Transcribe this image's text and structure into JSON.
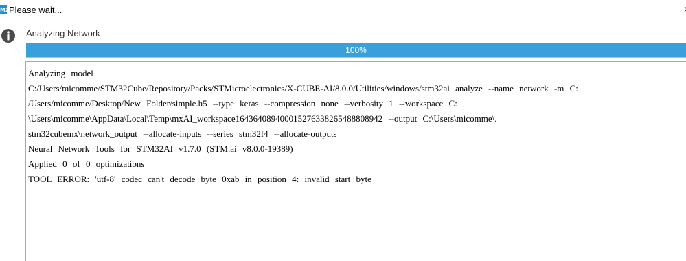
{
  "window": {
    "title": "Please wait...",
    "app_icon_text": "MX",
    "close_icon": "close-icon"
  },
  "status": {
    "icon": "info-icon",
    "label": "Analyzing Network"
  },
  "progress": {
    "percent": 100,
    "text": "100%",
    "fill_color": "#3aa0dc"
  },
  "log": {
    "lines": [
      "Analyzing model",
      "C:/Users/micomme/STM32Cube/Repository/Packs/STMicroelectronics/X-CUBE-AI/8.0.0/Utilities/windows/stm32ai analyze --name network -m C:",
      "/Users/micomme/Desktop/New Folder/simple.h5 --type keras --compression none --verbosity 1 --workspace C:",
      "\\Users\\micomme\\AppData\\Local\\Temp\\mxAI_workspace16436408940001527633826548880894​2 --output C:\\Users\\micomme\\.",
      "stm32cubemx\\network_output --allocate-inputs --series stm32f4 --allocate-outputs",
      "Neural Network Tools for STM32AI v1.7.0 (STM.ai v8.0.0-19389)",
      "Applied 0 of 0 optimizations",
      "TOOL ERROR: 'utf-8' codec can't decode byte 0xab in position 4: invalid start byte"
    ]
  }
}
